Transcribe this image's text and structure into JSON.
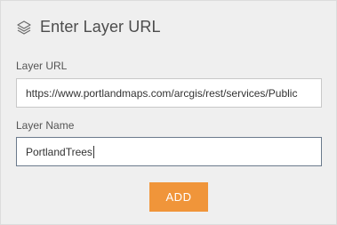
{
  "dialog": {
    "title": "Enter Layer URL",
    "title_icon": "layers-icon"
  },
  "layer_url": {
    "label": "Layer URL",
    "value": "https://www.portlandmaps.com/arcgis/rest/services/Public"
  },
  "layer_name": {
    "label": "Layer Name",
    "value": "PortlandTrees"
  },
  "actions": {
    "add_label": "ADD",
    "add_color": "#f0953a"
  },
  "colors": {
    "panel_background": "#efefef",
    "text": "#4c4c4c"
  }
}
